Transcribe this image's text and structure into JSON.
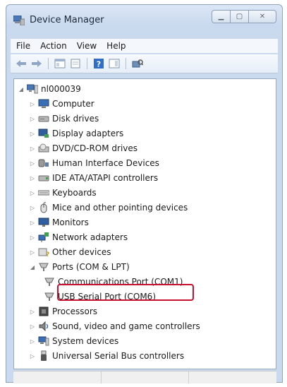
{
  "window": {
    "title": "Device Manager"
  },
  "menu": [
    "File",
    "Action",
    "View",
    "Help"
  ],
  "tree": {
    "root": "nl000039",
    "items": [
      {
        "label": "Computer",
        "icon": "computer-icon"
      },
      {
        "label": "Disk drives",
        "icon": "disk-drive-icon"
      },
      {
        "label": "Display adapters",
        "icon": "display-adapter-icon"
      },
      {
        "label": "DVD/CD-ROM drives",
        "icon": "dvd-drive-icon"
      },
      {
        "label": "Human Interface Devices",
        "icon": "hid-icon"
      },
      {
        "label": "IDE ATA/ATAPI controllers",
        "icon": "ide-controller-icon"
      },
      {
        "label": "Keyboards",
        "icon": "keyboard-icon"
      },
      {
        "label": "Mice and other pointing devices",
        "icon": "mouse-icon"
      },
      {
        "label": "Monitors",
        "icon": "monitor-icon"
      },
      {
        "label": "Network adapters",
        "icon": "network-adapter-icon"
      },
      {
        "label": "Other devices",
        "icon": "other-devices-icon"
      },
      {
        "label": "Ports (COM & LPT)",
        "icon": "port-icon"
      },
      {
        "label": "Communications Port (COM1)",
        "icon": "port-icon"
      },
      {
        "label": "USB Serial Port (COM6)",
        "icon": "port-icon"
      },
      {
        "label": "Processors",
        "icon": "processor-icon"
      },
      {
        "label": "Sound, video and game controllers",
        "icon": "sound-icon"
      },
      {
        "label": "System devices",
        "icon": "system-devices-icon"
      },
      {
        "label": "Universal Serial Bus controllers",
        "icon": "usb-icon"
      }
    ]
  },
  "colors": {
    "highlight": "#c8102e",
    "frame": "#c9d9ee"
  }
}
